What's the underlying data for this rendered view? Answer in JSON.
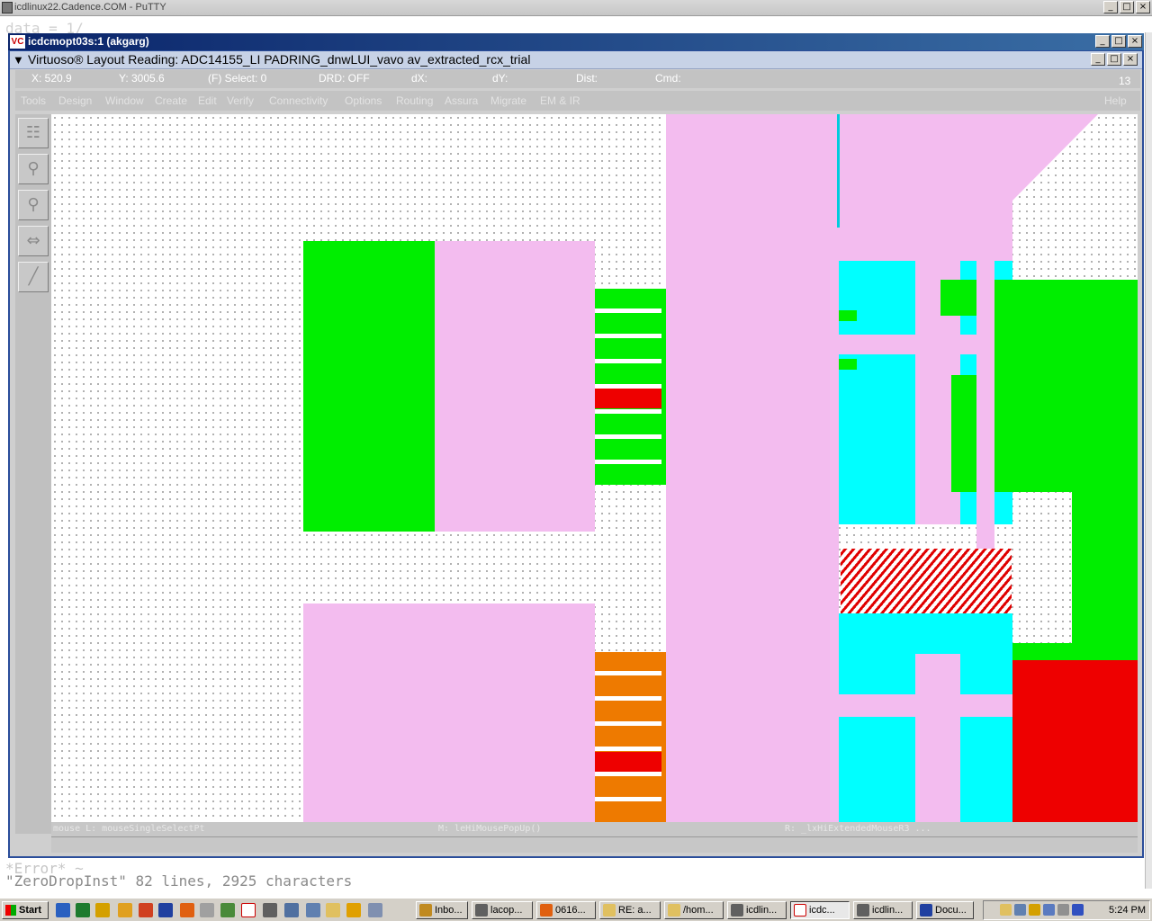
{
  "putty": {
    "title": "icdlinux22.Cadence.COM - PuTTY",
    "bg_text": "data = 1/",
    "line1": "*Error* ~",
    "line2": "\"ZeroDropInst\" 82 lines, 2925 characters"
  },
  "vnc": {
    "title": "icdcmopt03s:1 (akgarg)",
    "icon": "VC"
  },
  "virtuoso": {
    "title": "Virtuoso® Layout Reading: ADC14155_LI PADRING_dnwLUI_vavo av_extracted_rcx_trial",
    "status": {
      "x": "X:  520.9",
      "y": "Y:  3005.6",
      "select": "(F) Select: 0",
      "drd": "DRD: OFF",
      "dx": "dX:",
      "dy": "dY:",
      "dist": "Dist:",
      "cmd": "Cmd:",
      "number": "13"
    },
    "menus": [
      "Tools",
      "Design",
      "Window",
      "Create",
      "Edit",
      "Verify",
      "Connectivity",
      "Options",
      "Routing",
      "Assura",
      "Migrate",
      "EM & IR",
      "Help"
    ],
    "tools": [
      "layer-icon",
      "zoom-in-icon",
      "zoom-out-icon",
      "stretch-icon",
      "ruler-icon"
    ],
    "mouse_left": "mouse L: mouseSingleSelectPt",
    "mouse_mid": "M: leHiMousePopUp()",
    "mouse_right": "R: _lxHiExtendedMouseR3 ..."
  },
  "taskbar": {
    "start": "Start",
    "tasks": [
      "Inbo...",
      "lacop...",
      "0616...",
      "RE: a...",
      "/hom...",
      "icdlin...",
      "icdc...",
      "icdlin...",
      "Docu..."
    ],
    "clock": "5:24 PM"
  },
  "colors": {
    "pink": "#f3bcef",
    "green": "#00ee00",
    "red": "#ee0000",
    "cyan": "#00ffff",
    "orange": "#ee7a00"
  }
}
